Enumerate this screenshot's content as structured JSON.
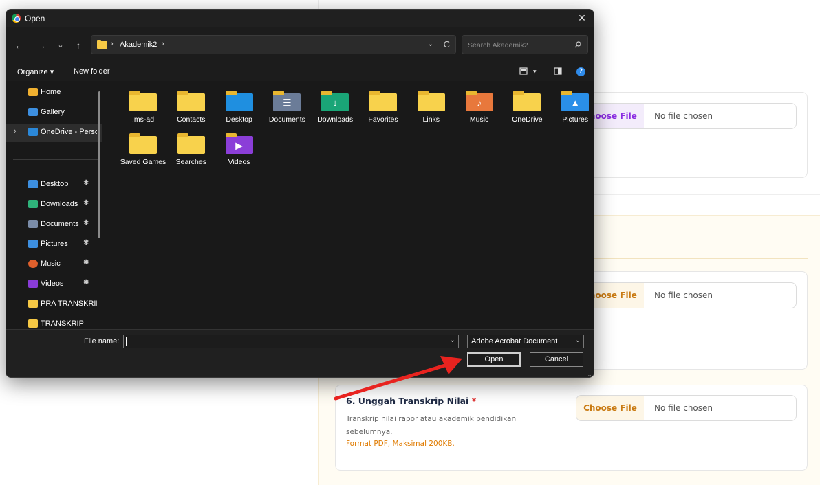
{
  "dialog": {
    "title": "Open",
    "close_glyph": "✕",
    "nav": {
      "back": "←",
      "forward": "→",
      "recent": "⌄",
      "up": "↑"
    },
    "breadcrumb": {
      "sep": "›",
      "folder": "Akademik2",
      "trail": "›"
    },
    "address_dropdown": "⌄",
    "refresh": "C",
    "search": {
      "placeholder": "Search Akademik2"
    },
    "commands": {
      "organize": "Organize ▾",
      "new_folder": "New folder",
      "view_dropdown": "▾",
      "help": "?"
    },
    "sidebar": {
      "top": [
        {
          "label": "Home",
          "color": "#f0b030"
        },
        {
          "label": "Gallery",
          "color": "#3d8fe0"
        },
        {
          "label": "OneDrive - Perso",
          "color": "#2b88d8",
          "chevron": "›"
        }
      ],
      "pinned": [
        {
          "label": "Desktop",
          "color": "#3d8fe0",
          "pin": "📌"
        },
        {
          "label": "Downloads",
          "color": "#2fb37a",
          "pin": "📌"
        },
        {
          "label": "Documents",
          "color": "#7a8ca8",
          "pin": "📌"
        },
        {
          "label": "Pictures",
          "color": "#3d8fe0",
          "pin": "📌"
        },
        {
          "label": "Music",
          "color": "#e0602c",
          "pin": "📌"
        },
        {
          "label": "Videos",
          "color": "#8a3cd8",
          "pin": "📌"
        },
        {
          "label": "PRA TRANSKRIP",
          "color": "#f6c945"
        },
        {
          "label": "TRANSKRIP",
          "color": "#f6c945"
        }
      ]
    },
    "files": [
      {
        "name": ".ms-ad",
        "kind": "folder",
        "color": "#f8d24c",
        "badge": ""
      },
      {
        "name": "Contacts",
        "kind": "folder",
        "color": "#f8d24c",
        "badge": ""
      },
      {
        "name": "Desktop",
        "kind": "folder",
        "color": "#1f8fe0",
        "badge": ""
      },
      {
        "name": "Documents",
        "kind": "folder",
        "color": "#6b7c98",
        "badge": "☰"
      },
      {
        "name": "Downloads",
        "kind": "folder",
        "color": "#1aa577",
        "badge": "↓"
      },
      {
        "name": "Favorites",
        "kind": "folder",
        "color": "#f8d24c",
        "badge": ""
      },
      {
        "name": "Links",
        "kind": "folder",
        "color": "#f8d24c",
        "badge": ""
      },
      {
        "name": "Music",
        "kind": "folder",
        "color": "#e8783c",
        "badge": "♪"
      },
      {
        "name": "OneDrive",
        "kind": "folder",
        "color": "#f8d24c",
        "badge": ""
      },
      {
        "name": "Pictures",
        "kind": "folder",
        "color": "#2a8fe8",
        "badge": "▲"
      },
      {
        "name": "Saved Games",
        "kind": "folder",
        "color": "#f8d24c",
        "badge": ""
      },
      {
        "name": "Searches",
        "kind": "folder",
        "color": "#f8d24c",
        "badge": ""
      },
      {
        "name": "Videos",
        "kind": "folder",
        "color": "#8b3ed8",
        "badge": "▶"
      }
    ],
    "footer": {
      "file_name_label": "File name:",
      "file_name_value": "",
      "file_name_dropdown": "⌄",
      "file_type": "Adobe Acrobat Document",
      "file_type_dropdown": "⌄",
      "open_label": "Open",
      "cancel_label": "Cancel"
    }
  },
  "page": {
    "inputs": [
      {
        "button": "Choose File",
        "status": "No file chosen"
      },
      {
        "button": "Choose File",
        "status": "No file chosen"
      },
      {
        "button": "Choose File",
        "status": "No file chosen"
      }
    ],
    "upload": {
      "title": "6. Unggah Transkrip Nilai",
      "required": "*",
      "description": "Transkrip nilai rapor atau akademik pendidikan sebelumnya.",
      "format": "Format PDF, Maksimal 200KB."
    }
  },
  "annotation": {
    "arrow_color": "#e8231f"
  }
}
